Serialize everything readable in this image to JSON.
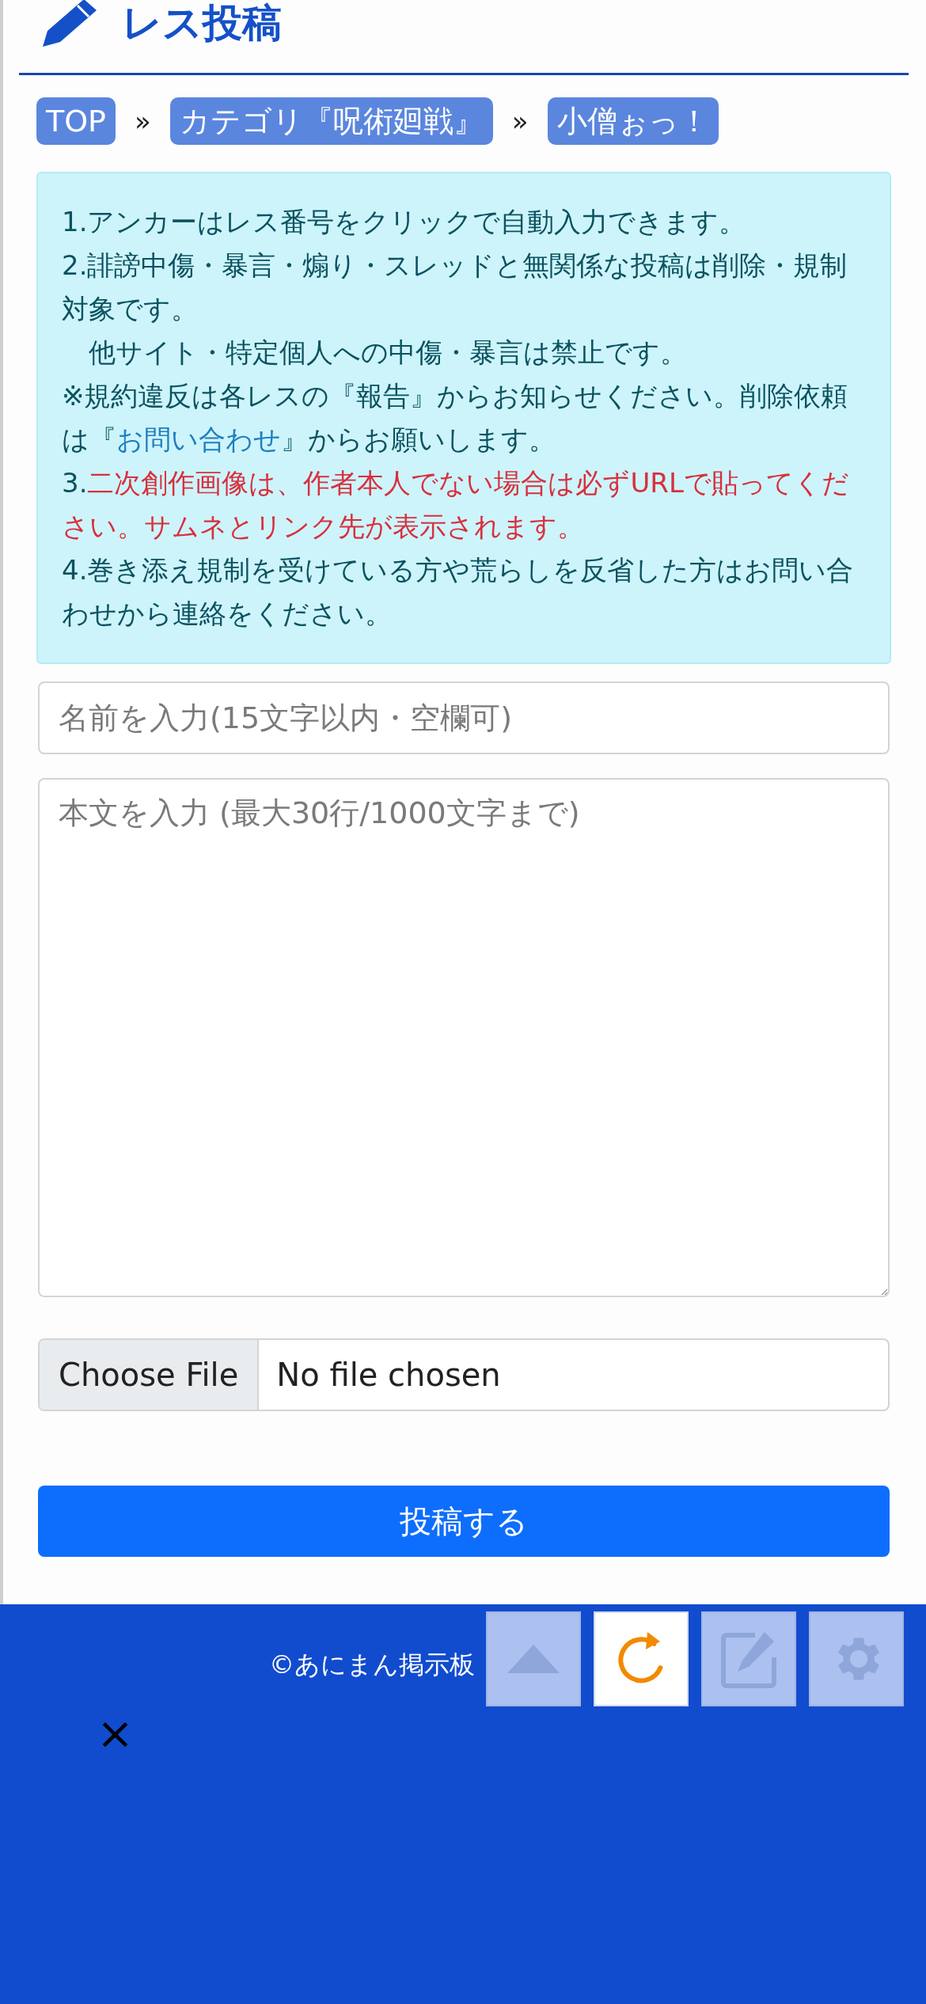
{
  "header": {
    "title": "レス投稿"
  },
  "breadcrumbs": [
    {
      "label": "TOP"
    },
    {
      "separator": "»",
      "label": "カテゴリ『呪術廻戦』"
    },
    {
      "separator": "»",
      "label": "小僧ぉっ！"
    }
  ],
  "notices": [
    {
      "segments": [
        {
          "kind": "plain",
          "text": "1.アンカーはレス番号をクリックで自動入力できます。"
        }
      ]
    },
    {
      "segments": [
        {
          "kind": "plain",
          "text": "2.誹謗中傷・暴言・煽り・スレッドと無関係な投稿は削除・規制対象です。"
        }
      ]
    },
    {
      "segments": [
        {
          "kind": "plain",
          "text": "　他サイト・特定個人への中傷・暴言は禁止です。"
        }
      ]
    },
    {
      "segments": [
        {
          "kind": "plain",
          "text": "※規約違反は各レスの『報告』からお知らせください。削除依頼は『"
        },
        {
          "kind": "link",
          "text": "お問い合わせ"
        },
        {
          "kind": "plain",
          "text": "』からお願いします。"
        }
      ]
    },
    {
      "segments": [
        {
          "kind": "plain",
          "text": "3."
        },
        {
          "kind": "alert",
          "text": "二次創作画像は、作者本人でない場合は必ずURLで貼ってください。サムネとリンク先が表示されます。"
        }
      ]
    },
    {
      "segments": [
        {
          "kind": "plain",
          "text": "4.巻き添え規制を受けている方や荒らしを反省した方はお問い合わせから連絡をください。"
        }
      ]
    }
  ],
  "name_field": {
    "placeholder": "名前を入力(15文字以内・空欄可)"
  },
  "body_field": {
    "placeholder": "本文を入力 (最大30行/1000文字まで)"
  },
  "file_input": {
    "button": "Choose File",
    "status": "No file chosen"
  },
  "submit_button": "投稿する",
  "footer": {
    "copyright": "©あにまん掲示板"
  },
  "floating_buttons": [
    {
      "kind": "top",
      "selected": false
    },
    {
      "kind": "reload",
      "selected": true
    },
    {
      "kind": "edit",
      "selected": false
    },
    {
      "kind": "settings",
      "selected": false
    }
  ],
  "close_button": "×"
}
